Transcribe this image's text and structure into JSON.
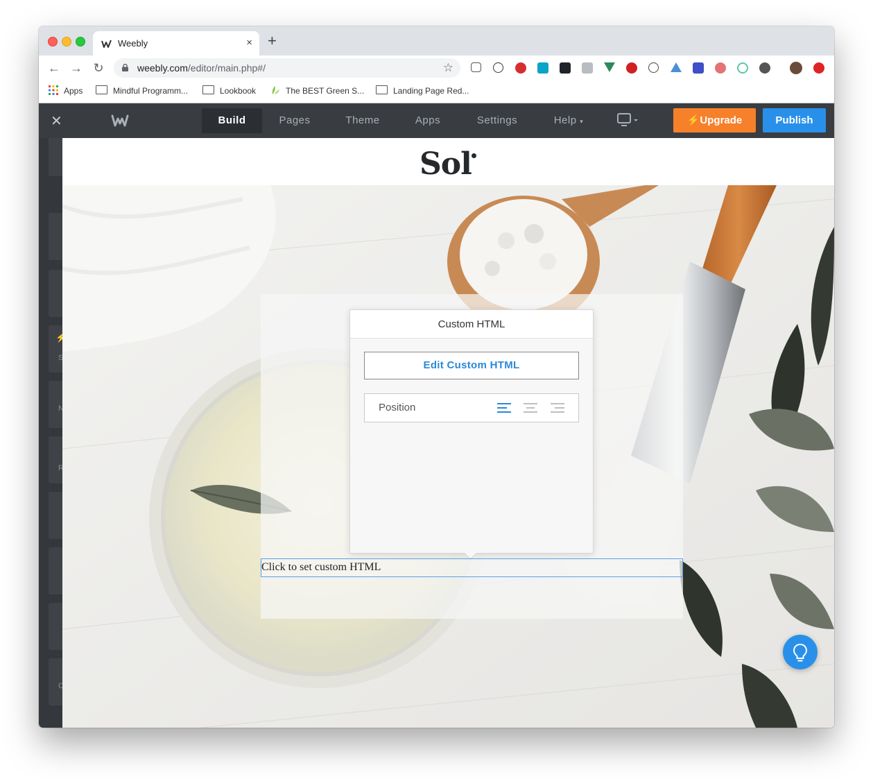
{
  "browser": {
    "tab_title": "Weebly",
    "url_domain": "weebly.com",
    "url_path": "/editor/main.php#/",
    "new_tab_glyph": "+",
    "close_tab_glyph": "×"
  },
  "bookmarks": [
    {
      "label": "Apps",
      "icon": "apps-grid-icon"
    },
    {
      "label": "Mindful Programm...",
      "icon": "folder-icon"
    },
    {
      "label": "Lookbook",
      "icon": "folder-icon"
    },
    {
      "label": "The BEST Green S...",
      "icon": "leaf-icon"
    },
    {
      "label": "Landing Page Red...",
      "icon": "folder-icon"
    }
  ],
  "editor": {
    "nav": [
      "Build",
      "Pages",
      "Theme",
      "Apps",
      "Settings",
      "Help"
    ],
    "active_nav": "Build",
    "upgrade_label": "Upgrade",
    "publish_label": "Publish",
    "accent_upgrade": "#f7802b",
    "accent_publish": "#2990ea"
  },
  "sidebar": {
    "letters": [
      "S",
      "N",
      "R",
      "C"
    ]
  },
  "site": {
    "logo_text": "Sol"
  },
  "popover": {
    "title": "Custom HTML",
    "edit_button": "Edit Custom HTML",
    "position_label": "Position",
    "position_selected": "left"
  },
  "custom_html_field": {
    "placeholder_text": "Click to set custom HTML"
  }
}
